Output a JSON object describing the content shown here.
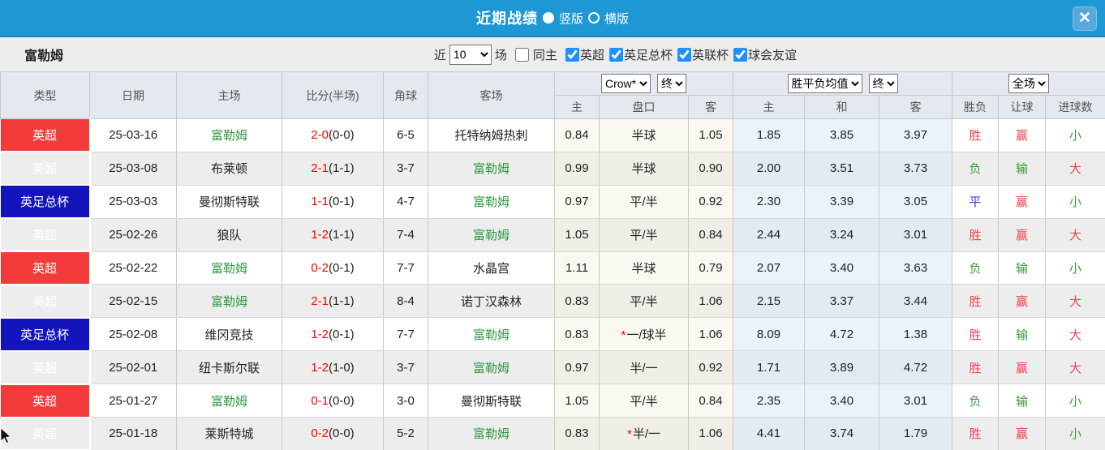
{
  "title_bar": {
    "title": "近期战绩",
    "radio_vertical": "竖版",
    "radio_horizontal": "横版",
    "close_glyph": "✕"
  },
  "filter_bar": {
    "team": "富勒姆",
    "near_label": "近",
    "match_count": "10",
    "field_label": "场",
    "same_home_label": "同主",
    "same_home_checked": false,
    "leagues": [
      {
        "label": "英超",
        "checked": true
      },
      {
        "label": "英足总杯",
        "checked": true
      },
      {
        "label": "英联杯",
        "checked": true
      },
      {
        "label": "球会友谊",
        "checked": true
      }
    ]
  },
  "table": {
    "left_headers": [
      "类型",
      "日期",
      "主场",
      "比分(半场)",
      "角球",
      "客场"
    ],
    "group1": {
      "select1": "Crow*",
      "select2": "终",
      "cols": [
        "主",
        "盘口",
        "客"
      ]
    },
    "group2": {
      "select1": "胜平负均值",
      "select2": "终",
      "cols": [
        "主",
        "和",
        "客"
      ]
    },
    "group3": {
      "select1": "全场",
      "cols": [
        "胜负",
        "让球",
        "进球数"
      ]
    },
    "rows": [
      {
        "league": "英超",
        "league_color": "red",
        "date": "25-03-16",
        "home": "富勒姆",
        "home_highlight": true,
        "score": "2-0",
        "half_score": "(0-0)",
        "corners": "6-5",
        "away": "托特纳姆热刺",
        "away_highlight": false,
        "odds_home": "0.84",
        "handicap": "半球",
        "handicap_star": false,
        "odds_away": "1.05",
        "avg_home": "1.85",
        "avg_draw": "3.85",
        "avg_away": "3.97",
        "result_wdl": "胜",
        "result_wdl_color": "red",
        "result_handicap": "赢",
        "result_handicap_color": "red",
        "result_goals": "小",
        "result_goals_color": "green"
      },
      {
        "league": "英超",
        "league_color": "red",
        "date": "25-03-08",
        "home": "布莱顿",
        "home_highlight": false,
        "score": "2-1",
        "half_score": "(1-1)",
        "corners": "3-7",
        "away": "富勒姆",
        "away_highlight": true,
        "odds_home": "0.99",
        "handicap": "半球",
        "handicap_star": false,
        "odds_away": "0.90",
        "avg_home": "2.00",
        "avg_draw": "3.51",
        "avg_away": "3.73",
        "result_wdl": "负",
        "result_wdl_color": "green",
        "result_handicap": "输",
        "result_handicap_color": "green",
        "result_goals": "大",
        "result_goals_color": "red"
      },
      {
        "league": "英足总杯",
        "league_color": "blue",
        "date": "25-03-03",
        "home": "曼彻斯特联",
        "home_highlight": false,
        "score": "1-1",
        "half_score": "(0-1)",
        "corners": "4-7",
        "away": "富勒姆",
        "away_highlight": true,
        "odds_home": "0.97",
        "handicap": "平/半",
        "handicap_star": false,
        "odds_away": "0.92",
        "avg_home": "2.30",
        "avg_draw": "3.39",
        "avg_away": "3.05",
        "result_wdl": "平",
        "result_wdl_color": "blue",
        "result_handicap": "赢",
        "result_handicap_color": "red",
        "result_goals": "小",
        "result_goals_color": "green"
      },
      {
        "league": "英超",
        "league_color": "red",
        "date": "25-02-26",
        "home": "狼队",
        "home_highlight": false,
        "score": "1-2",
        "half_score": "(1-1)",
        "corners": "7-4",
        "away": "富勒姆",
        "away_highlight": true,
        "odds_home": "1.05",
        "handicap": "平/半",
        "handicap_star": false,
        "odds_away": "0.84",
        "avg_home": "2.44",
        "avg_draw": "3.24",
        "avg_away": "3.01",
        "result_wdl": "胜",
        "result_wdl_color": "red",
        "result_handicap": "赢",
        "result_handicap_color": "red",
        "result_goals": "大",
        "result_goals_color": "red"
      },
      {
        "league": "英超",
        "league_color": "red",
        "date": "25-02-22",
        "home": "富勒姆",
        "home_highlight": true,
        "score": "0-2",
        "half_score": "(0-1)",
        "corners": "7-7",
        "away": "水晶宫",
        "away_highlight": false,
        "odds_home": "1.11",
        "handicap": "半球",
        "handicap_star": false,
        "odds_away": "0.79",
        "avg_home": "2.07",
        "avg_draw": "3.40",
        "avg_away": "3.63",
        "result_wdl": "负",
        "result_wdl_color": "green",
        "result_handicap": "输",
        "result_handicap_color": "green",
        "result_goals": "小",
        "result_goals_color": "green"
      },
      {
        "league": "英超",
        "league_color": "red",
        "date": "25-02-15",
        "home": "富勒姆",
        "home_highlight": true,
        "score": "2-1",
        "half_score": "(1-1)",
        "corners": "8-4",
        "away": "诺丁汉森林",
        "away_highlight": false,
        "odds_home": "0.83",
        "handicap": "平/半",
        "handicap_star": false,
        "odds_away": "1.06",
        "avg_home": "2.15",
        "avg_draw": "3.37",
        "avg_away": "3.44",
        "result_wdl": "胜",
        "result_wdl_color": "red",
        "result_handicap": "赢",
        "result_handicap_color": "red",
        "result_goals": "大",
        "result_goals_color": "red"
      },
      {
        "league": "英足总杯",
        "league_color": "blue",
        "date": "25-02-08",
        "home": "维冈竞技",
        "home_highlight": false,
        "score": "1-2",
        "half_score": "(0-1)",
        "corners": "7-7",
        "away": "富勒姆",
        "away_highlight": true,
        "odds_home": "0.83",
        "handicap": "一/球半",
        "handicap_star": true,
        "odds_away": "1.06",
        "avg_home": "8.09",
        "avg_draw": "4.72",
        "avg_away": "1.38",
        "result_wdl": "胜",
        "result_wdl_color": "red",
        "result_handicap": "输",
        "result_handicap_color": "green",
        "result_goals": "大",
        "result_goals_color": "red"
      },
      {
        "league": "英超",
        "league_color": "red",
        "date": "25-02-01",
        "home": "纽卡斯尔联",
        "home_highlight": false,
        "score": "1-2",
        "half_score": "(1-0)",
        "corners": "3-7",
        "away": "富勒姆",
        "away_highlight": true,
        "odds_home": "0.97",
        "handicap": "半/一",
        "handicap_star": false,
        "odds_away": "0.92",
        "avg_home": "1.71",
        "avg_draw": "3.89",
        "avg_away": "4.72",
        "result_wdl": "胜",
        "result_wdl_color": "red",
        "result_handicap": "赢",
        "result_handicap_color": "red",
        "result_goals": "大",
        "result_goals_color": "red"
      },
      {
        "league": "英超",
        "league_color": "red",
        "date": "25-01-27",
        "home": "富勒姆",
        "home_highlight": true,
        "score": "0-1",
        "half_score": "(0-0)",
        "corners": "3-0",
        "away": "曼彻斯特联",
        "away_highlight": false,
        "odds_home": "1.05",
        "handicap": "平/半",
        "handicap_star": false,
        "odds_away": "0.84",
        "avg_home": "2.35",
        "avg_draw": "3.40",
        "avg_away": "3.01",
        "result_wdl": "负",
        "result_wdl_color": "green",
        "result_handicap": "输",
        "result_handicap_color": "green",
        "result_goals": "小",
        "result_goals_color": "green"
      },
      {
        "league": "英超",
        "league_color": "red",
        "date": "25-01-18",
        "home": "莱斯特城",
        "home_highlight": false,
        "score": "0-2",
        "half_score": "(0-0)",
        "corners": "5-2",
        "away": "富勒姆",
        "away_highlight": true,
        "odds_home": "0.83",
        "handicap": "半/一",
        "handicap_star": true,
        "odds_away": "1.06",
        "avg_home": "4.41",
        "avg_draw": "3.74",
        "avg_away": "1.79",
        "result_wdl": "胜",
        "result_wdl_color": "red",
        "result_handicap": "赢",
        "result_handicap_color": "red",
        "result_goals": "小",
        "result_goals_color": "green"
      }
    ]
  },
  "colors": {
    "titlebar_blue": "#1e97d5",
    "badge_red": "#f43b3b",
    "badge_blue": "#1414bd",
    "team_green": "#2e9940",
    "score_red": "#ff0000",
    "result_red": "#f0434f",
    "result_green": "#3a9c3a",
    "result_blue": "#3a3ad6",
    "checkbox_blue": "#1e90ff",
    "odds_col_bg": "#faf8f0",
    "avg_col_bg": "#eaf3fa"
  }
}
